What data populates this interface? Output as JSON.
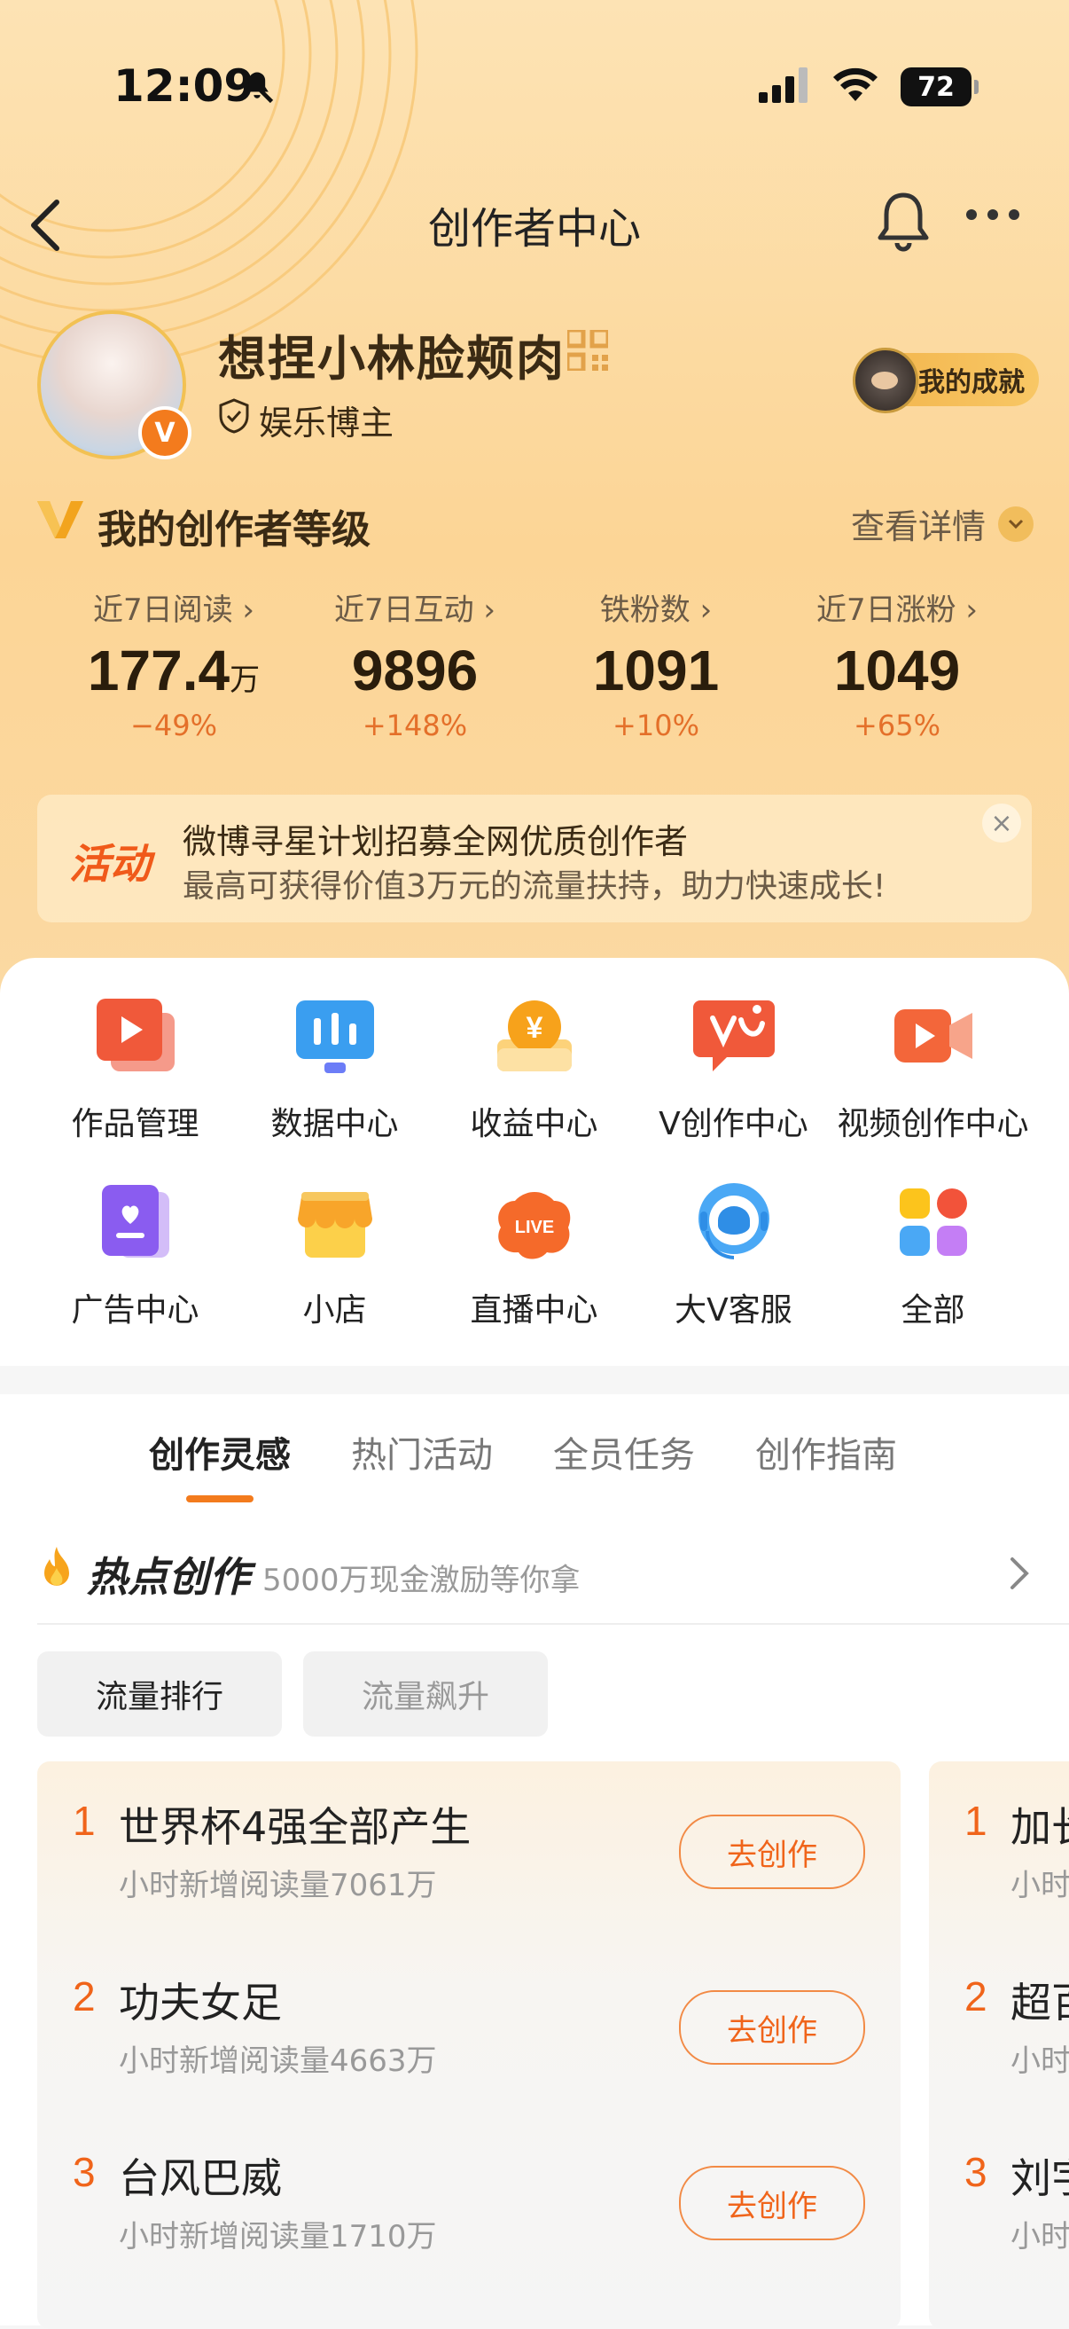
{
  "status": {
    "time": "12:09",
    "battery": "72"
  },
  "nav": {
    "title": "创作者中心"
  },
  "profile": {
    "username": "想捏小林脸颊肉",
    "role": "娱乐博主",
    "achievement": "我的成就"
  },
  "level": {
    "title": "我的创作者等级",
    "detail_link": "查看详情"
  },
  "stats": [
    {
      "label": "近7日阅读",
      "value": "177.4",
      "unit": "万",
      "change": "−49%"
    },
    {
      "label": "近7日互动",
      "value": "9896",
      "unit": "",
      "change": "+148%"
    },
    {
      "label": "铁粉数",
      "value": "1091",
      "unit": "",
      "change": "+10%"
    },
    {
      "label": "近7日涨粉",
      "value": "1049",
      "unit": "",
      "change": "+65%"
    }
  ],
  "banner": {
    "tag": "活动",
    "line1": "微博寻星计划招募全网优质创作者",
    "line2": "最高可获得价值3万元的流量扶持，助力快速成长!",
    "close": "×"
  },
  "tools": [
    {
      "label": "作品管理",
      "icon": "works-icon"
    },
    {
      "label": "数据中心",
      "icon": "data-center-icon"
    },
    {
      "label": "收益中心",
      "icon": "income-icon"
    },
    {
      "label": "V创作中心",
      "icon": "v-create-icon"
    },
    {
      "label": "视频创作中心",
      "icon": "video-create-icon"
    },
    {
      "label": "广告中心",
      "icon": "ad-center-icon"
    },
    {
      "label": "小店",
      "icon": "shop-icon"
    },
    {
      "label": "直播中心",
      "icon": "live-icon"
    },
    {
      "label": "大V客服",
      "icon": "customer-service-icon"
    },
    {
      "label": "全部",
      "icon": "all-apps-icon"
    }
  ],
  "live_badge": "LIVE",
  "tabs": [
    "创作灵感",
    "热门活动",
    "全员任务",
    "创作指南"
  ],
  "hot": {
    "title": "热点创作",
    "subtitle": "5000万现金激励等你拿"
  },
  "chips": [
    "流量排行",
    "流量飙升"
  ],
  "rank_list": [
    {
      "rank": "1",
      "title": "世界杯4强全部产生",
      "sub": "小时新增阅读量7061万",
      "button": "去创作"
    },
    {
      "rank": "2",
      "title": "功夫女足",
      "sub": "小时新增阅读量4663万",
      "button": "去创作"
    },
    {
      "rank": "3",
      "title": "台风巴威",
      "sub": "小时新增阅读量1710万",
      "button": "去创作"
    }
  ],
  "rank_list_2": [
    {
      "rank": "1",
      "title": "加长",
      "sub": "小时"
    },
    {
      "rank": "2",
      "title": "超百",
      "sub": "小时"
    },
    {
      "rank": "3",
      "title": "刘宇",
      "sub": "小时"
    }
  ],
  "colors": {
    "accent": "#f37b1d",
    "rank_number": "#f0641a",
    "header_bg": "#fcd596"
  }
}
